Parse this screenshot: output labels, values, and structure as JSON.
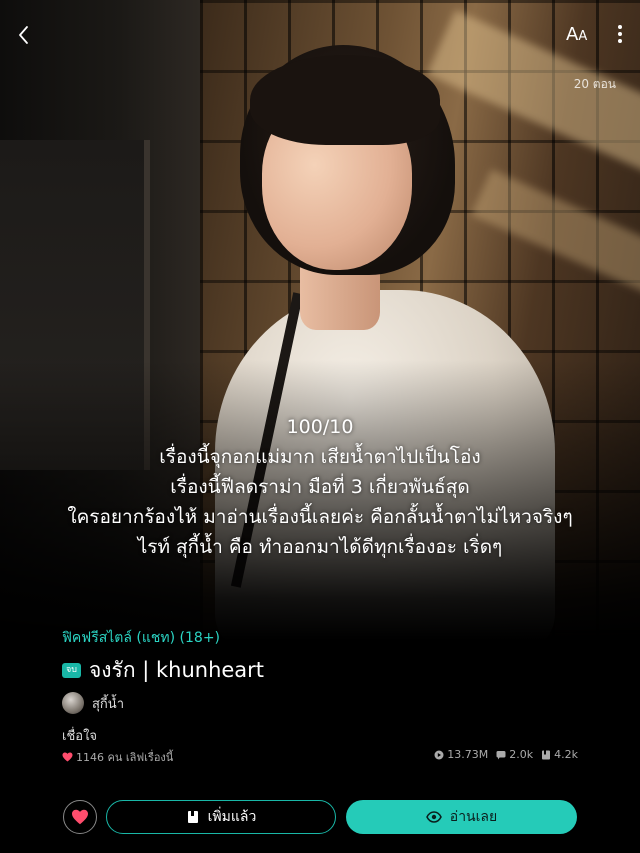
{
  "header": {
    "font_size_label_big": "A",
    "font_size_label_small": "A",
    "episode_count": "20 ตอน"
  },
  "review": {
    "lines": [
      "100/10",
      "เรื่องนี้จุกอกแม่มาก เสียน้ำตาไปเป็นโอ่ง",
      "เรื่องนี้ฟีลดราม่า มือที่ 3 เกี่ยวพันธ์สุด",
      "ใครอยากร้องไห้ มาอ่านเรื่องนี้เลยค่ะ  คือกลั้นน้ำตาไม่ไหวจริงๆ",
      "ไรท์ สุกี้น้ำ คือ ทำออกมาได้ดีทุกเรื่องอะ เริ่ดๆ"
    ]
  },
  "story": {
    "genre": "ฟิคฟรีสไตล์ (แชท) (18+)",
    "status_badge": "จบ",
    "title": "จงรัก | khunheart",
    "author": "สุกี้น้ำ",
    "tagline": "เชื่อใจ",
    "likes_text": "1146 คน เลิฟเรื่องนี้",
    "stats": {
      "views": "13.73M",
      "comments": "2.0k",
      "saves": "4.2k"
    }
  },
  "actions": {
    "library_label": "เพิ่มแล้ว",
    "read_label": "อ่านเลย"
  },
  "colors": {
    "accent": "#25cbb8",
    "genre_text": "#2bd4c3",
    "heart": "#ff4d6d",
    "background": "#000000"
  },
  "icons": [
    "back-icon",
    "font-size-icon",
    "more-icon",
    "heart-icon",
    "views-icon",
    "comments-icon",
    "saves-icon",
    "book-icon",
    "eye-icon"
  ]
}
